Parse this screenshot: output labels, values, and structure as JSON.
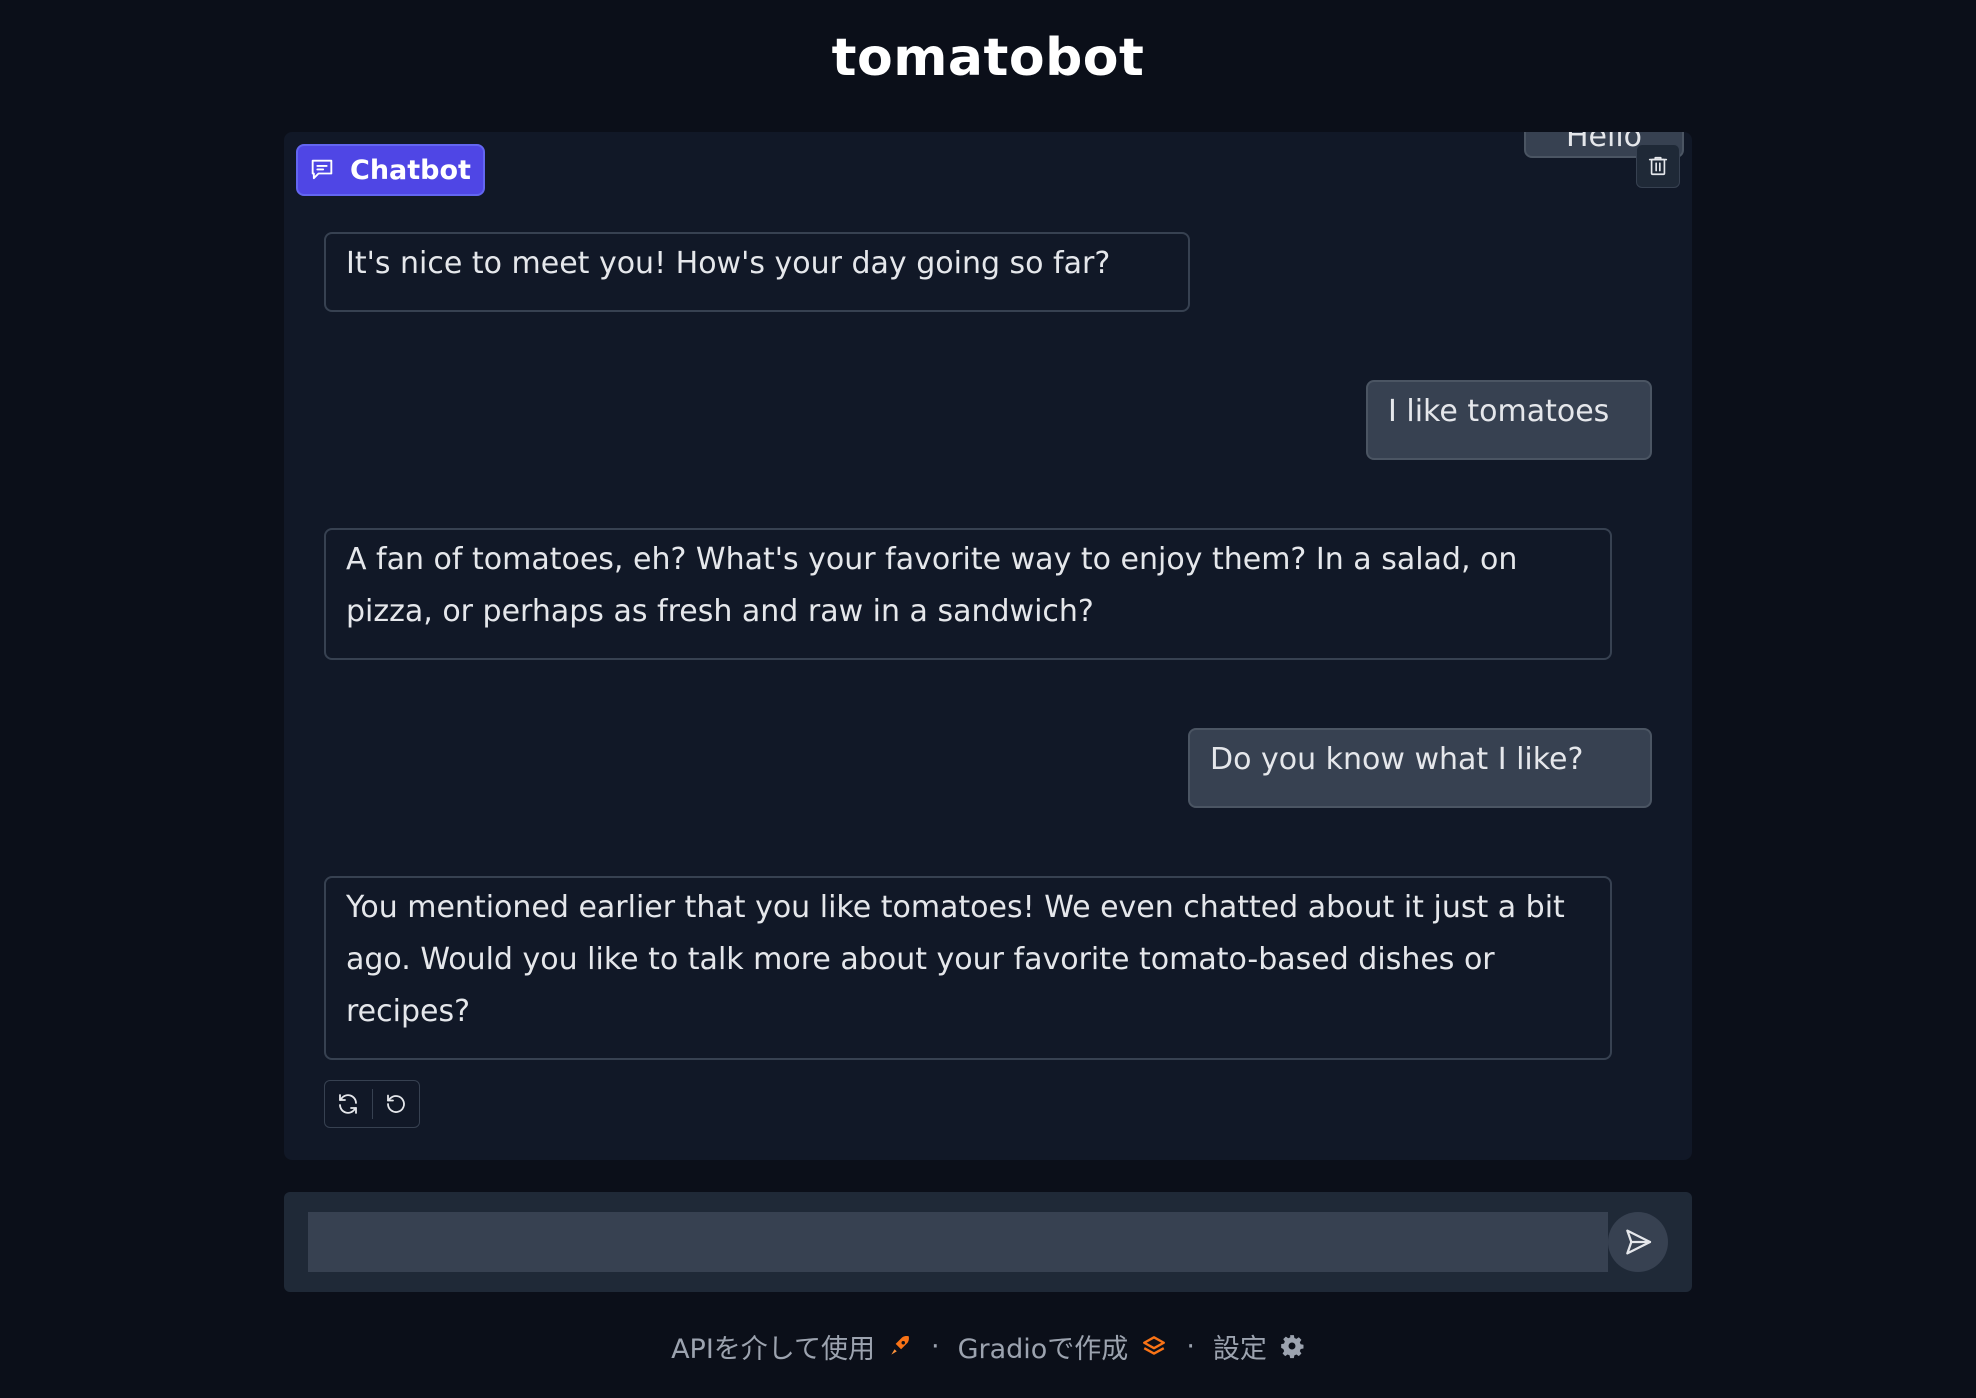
{
  "app": {
    "title": "tomatobot"
  },
  "chatbot": {
    "label": "Chatbot",
    "messages": [
      {
        "role": "user",
        "text": "Hello"
      },
      {
        "role": "bot",
        "text": "It's nice to meet you! How's your day going so far?"
      },
      {
        "role": "user",
        "text": "I like tomatoes"
      },
      {
        "role": "bot",
        "text": "A fan of tomatoes, eh? What's your favorite way to enjoy them? In a salad, on pizza, or perhaps as fresh and raw in a sandwich?"
      },
      {
        "role": "user",
        "text": "Do you know what I like?"
      },
      {
        "role": "bot",
        "text": "You mentioned earlier that you like tomatoes! We even chatted about it just a bit ago. Would you like to talk more about your favorite tomato-based dishes or recipes?"
      }
    ]
  },
  "input": {
    "value": "",
    "placeholder": ""
  },
  "footer": {
    "api": "APIを介して使用",
    "gradio": "Gradioで作成",
    "settings": "設定",
    "separator": "·"
  },
  "colors": {
    "background": "#0b0f19",
    "panel": "#111827",
    "accent": "#4f46e5",
    "gradio_orange": "#f97316"
  }
}
